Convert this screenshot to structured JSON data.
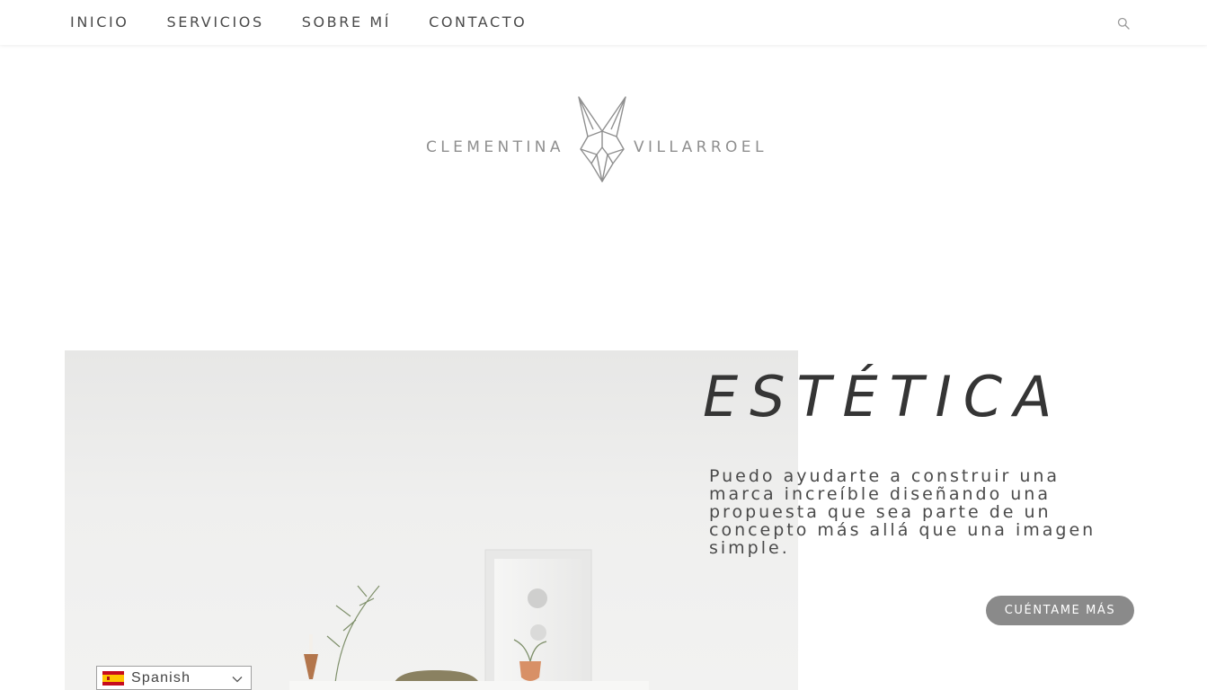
{
  "nav": {
    "items": [
      {
        "label": "INICIO"
      },
      {
        "label": "SERVICIOS"
      },
      {
        "label": "SOBRE MÍ"
      },
      {
        "label": "CONTACTO"
      }
    ],
    "search_icon": "search-icon"
  },
  "logo": {
    "first_name": "CLEMENTINA",
    "last_name": "VILLARROEL",
    "mark_icon": "rabbit-head-icon",
    "color": "#8f8f8f"
  },
  "hero": {
    "title": "ESTÉTICA",
    "description": "Puedo ayudarte a construir una marca increíble diseñando una propuesta que sea parte de un concepto más allá que una imagen simple.",
    "cta_label": "CUÉNTAME MÁS",
    "cta_color": "#8a8a8a"
  },
  "language": {
    "selected": "Spanish",
    "flag_icon": "spain-flag-icon",
    "chevron_icon": "chevron-down-icon"
  },
  "colors": {
    "text": "#353535",
    "nav_text": "#4a4a4a",
    "background": "#ffffff"
  }
}
